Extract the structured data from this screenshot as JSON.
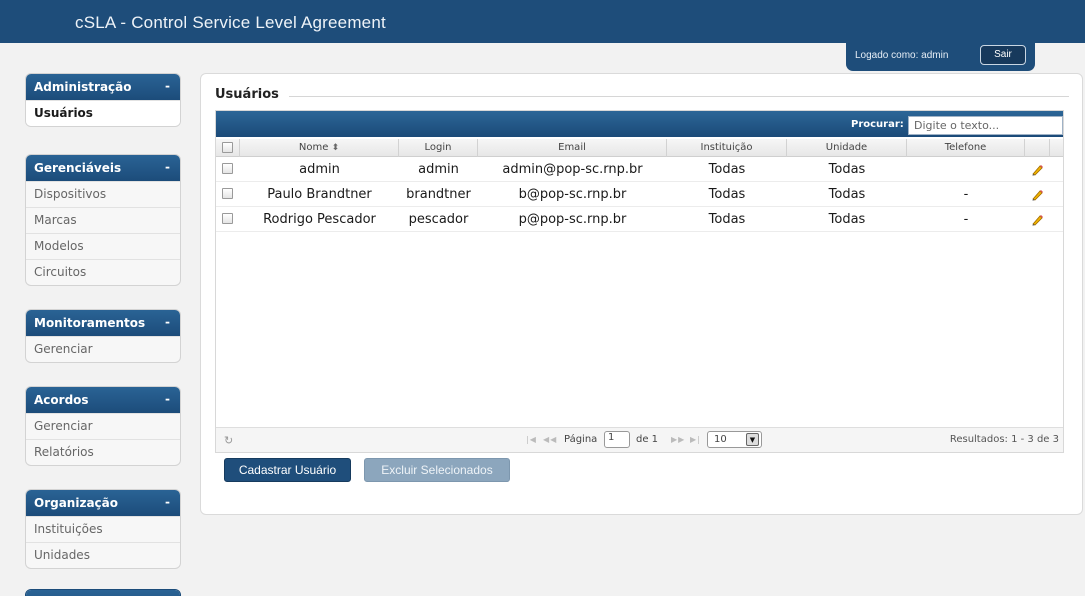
{
  "app": {
    "title": "cSLA - Control Service Level Agreement"
  },
  "user_box": {
    "label": "Logado como: admin",
    "logout": "Sair"
  },
  "sidebar": {
    "groups": [
      {
        "title": "Administração",
        "toggle": "-",
        "items": [
          "Usuários"
        ]
      },
      {
        "title": "Gerenciáveis",
        "toggle": "-",
        "items": [
          "Dispositivos",
          "Marcas",
          "Modelos",
          "Circuitos"
        ]
      },
      {
        "title": "Monitoramentos",
        "toggle": "-",
        "items": [
          "Gerenciar"
        ]
      },
      {
        "title": "Acordos",
        "toggle": "-",
        "items": [
          "Gerenciar",
          "Relatórios"
        ]
      },
      {
        "title": "Organização",
        "toggle": "-",
        "items": [
          "Instituições",
          "Unidades"
        ]
      }
    ]
  },
  "main": {
    "title": "Usuários",
    "search": {
      "label": "Procurar:",
      "placeholder": "Digite o texto..."
    },
    "columns": [
      "Nome",
      "Login",
      "Email",
      "Instituição",
      "Unidade",
      "Telefone"
    ],
    "sort_indicator": "⬍",
    "rows": [
      {
        "nome": "admin",
        "login": "admin",
        "email": "admin@pop-sc.rnp.br",
        "instituicao": "Todas",
        "unidade": "Todas",
        "telefone": ""
      },
      {
        "nome": "Paulo Brandtner",
        "login": "brandtner",
        "email": "b@pop-sc.rnp.br",
        "instituicao": "Todas",
        "unidade": "Todas",
        "telefone": "-"
      },
      {
        "nome": "Rodrigo Pescador",
        "login": "pescador",
        "email": "p@pop-sc.rnp.br",
        "instituicao": "Todas",
        "unidade": "Todas",
        "telefone": "-"
      }
    ],
    "pager": {
      "page_label": "Página",
      "page_value": "1",
      "of_label": "de 1",
      "page_size": "10",
      "results": "Resultados: 1 - 3 de 3"
    },
    "buttons": {
      "add": "Cadastrar Usuário",
      "delete": "Excluir Selecionados"
    }
  },
  "colors": {
    "brand": "#1e4d7a",
    "accent": "#2a6395",
    "disabled": "#8ca6bd"
  },
  "icons": {
    "edit": "pencil-icon",
    "refresh": "refresh-icon",
    "sort": "sort-icon"
  }
}
